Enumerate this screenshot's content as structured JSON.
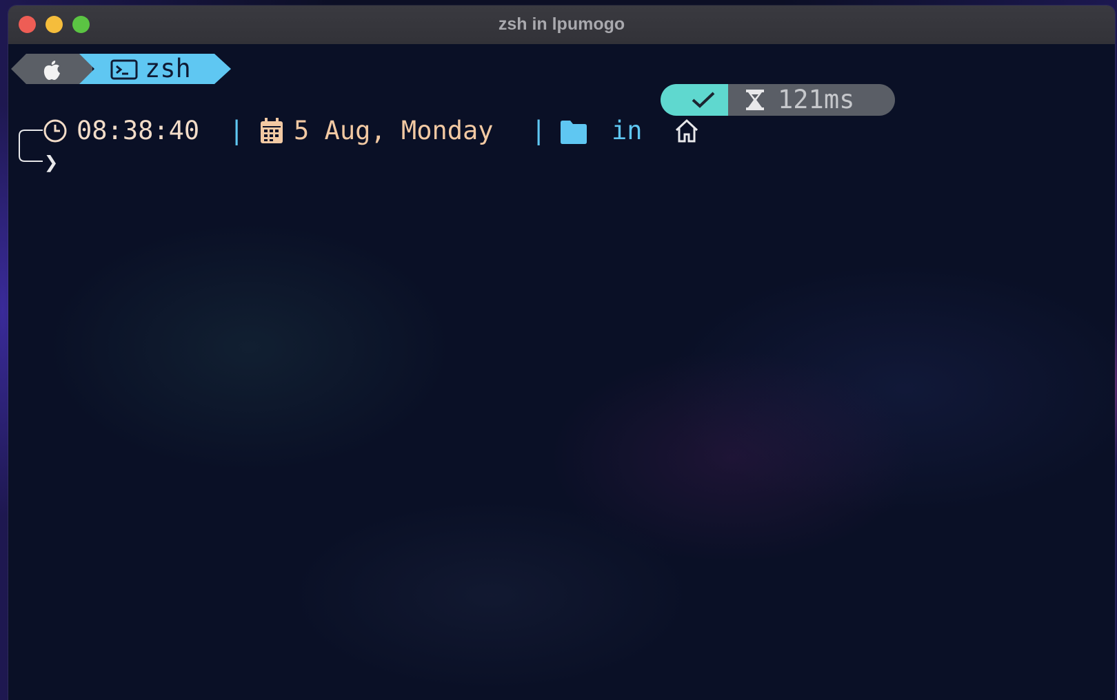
{
  "window": {
    "title": "zsh in lpumogo"
  },
  "prompt_top": {
    "os_icon": "apple-icon",
    "shell_icon": "terminal-icon",
    "shell_name": "zsh",
    "os_segment_color": "#5b5f66",
    "shell_segment_color": "#5fc7f2"
  },
  "status": {
    "exit_icon": "check-icon",
    "duration_icon": "hourglass-icon",
    "duration": "121ms",
    "ok_color": "#5fd8cf",
    "duration_bg": "#5a5e66"
  },
  "prompt_line": {
    "clock_icon": "clock-icon",
    "time": "08:38:40",
    "separator": "|",
    "calendar_icon": "calendar-icon",
    "date": "5 Aug, Monday",
    "folder_icon": "folder-icon",
    "in_label": "in",
    "home_icon": "home-icon",
    "chevron": "❯"
  }
}
